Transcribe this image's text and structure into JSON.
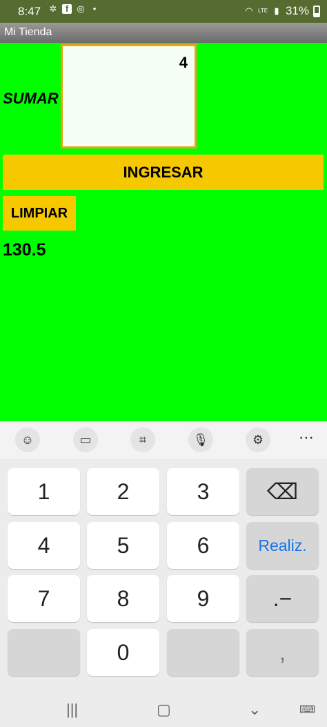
{
  "status_bar": {
    "time": "8:47",
    "battery": "31%",
    "icons": [
      "aperture-icon",
      "facebook-icon",
      "chrome-icon",
      "dot-icon",
      "wifi-icon",
      "volte-icon",
      "signal-icon",
      "battery-icon"
    ]
  },
  "app": {
    "title": "Mi Tienda",
    "sumar_label": "SUMAR",
    "input_value": "4",
    "ingresar_label": "INGRESAR",
    "limpiar_label": "LIMPIAR",
    "result": "130.5",
    "colors": {
      "background": "#00ff00",
      "button": "#f5c800",
      "input_border": "#e8a317"
    }
  },
  "keyboard": {
    "toolbar_icons": [
      "emoji-icon",
      "clipboard-icon",
      "keypad-icon",
      "microphone-icon",
      "settings-icon",
      "more-icon"
    ],
    "keys": {
      "k1": "1",
      "k2": "2",
      "k3": "3",
      "k4": "4",
      "k5": "5",
      "k6": "6",
      "k7": "7",
      "k8": "8",
      "k9": "9",
      "k0": "0",
      "done": "Realiz.",
      "dot_minus": ".−",
      "comma": ","
    }
  }
}
